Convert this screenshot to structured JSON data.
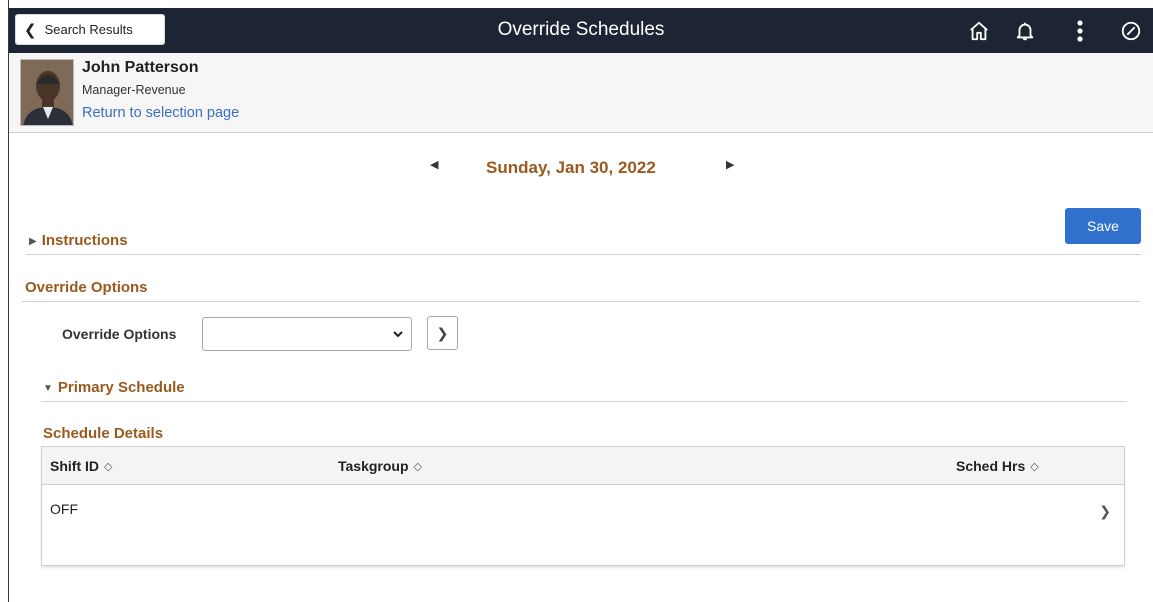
{
  "header": {
    "back_label": "Search Results",
    "title": "Override Schedules",
    "icons": [
      "home-icon",
      "bell-icon",
      "more-vertical-icon",
      "navbar-icon"
    ]
  },
  "person": {
    "name": "John Patterson",
    "job_title": "Manager-Revenue",
    "return_link": "Return to selection page"
  },
  "date_nav": {
    "date": "Sunday, Jan 30, 2022"
  },
  "save_label": "Save",
  "instructions_label": "Instructions",
  "override_section": {
    "title": "Override Options",
    "field_label": "Override Options",
    "selected_value": ""
  },
  "primary_schedule_label": "Primary Schedule",
  "schedule_details": {
    "title": "Schedule Details",
    "columns": [
      "Shift ID",
      "Taskgroup",
      "Sched Hrs"
    ],
    "rows": [
      {
        "shift_id": "OFF",
        "taskgroup": "",
        "sched_hrs": ""
      }
    ]
  },
  "colors": {
    "header_bg": "#1d2433",
    "accent_text": "#9a5a1f",
    "link": "#3c6ec4",
    "primary_button": "#2f71cc"
  }
}
